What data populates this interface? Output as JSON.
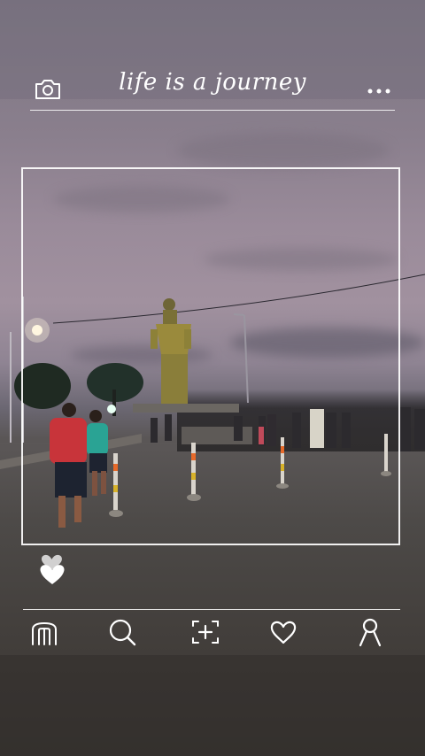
{
  "header": {
    "camera_icon": "camera-icon",
    "title": "life is a journey",
    "more_icon": "more-dots-icon"
  },
  "photo": {
    "subject": "statue-plaza-at-dusk"
  },
  "actions": {
    "like_icon": "heart-filled-icon"
  },
  "bottom_nav": {
    "items": [
      {
        "icon": "home-icon"
      },
      {
        "icon": "search-icon"
      },
      {
        "icon": "add-photo-icon"
      },
      {
        "icon": "heart-outline-icon"
      },
      {
        "icon": "profile-icon"
      }
    ]
  },
  "colors": {
    "frame": "#ffffff",
    "icon": "#ffffff",
    "sky_top": "#7d7683",
    "ground": "#433f3c"
  }
}
